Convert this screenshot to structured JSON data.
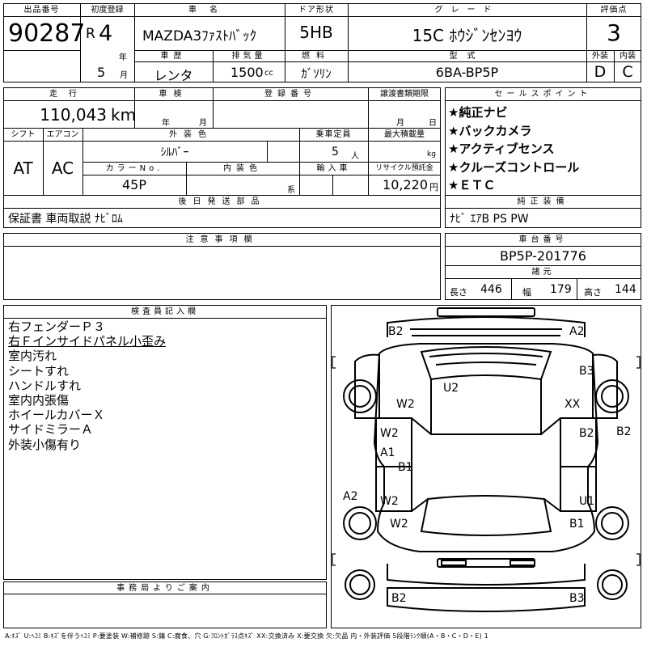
{
  "lot": {
    "header": "出品番号",
    "value": "90287"
  },
  "first_reg": {
    "header": "初度登録",
    "era": "R",
    "year": "4",
    "year_unit": "年",
    "month": "5",
    "month_unit": "月"
  },
  "car_name": {
    "header": "車名",
    "value": "MAZDA3ﾌｧｽﾄﾊﾞｯｸ"
  },
  "door": {
    "header": "ドア形状",
    "value": "5HB"
  },
  "grade": {
    "header": "グレード",
    "value": "15C ﾎｳｼﾞﾝｾﾝﾖｳ"
  },
  "score": {
    "header": "評価点",
    "value": "3"
  },
  "history": {
    "header": "車歴",
    "value": "レンタ"
  },
  "displacement": {
    "header": "排気量",
    "value": "1500",
    "unit": "cc"
  },
  "fuel": {
    "header": "燃料",
    "value": "ｶﾞｿﾘﾝ"
  },
  "model": {
    "header": "型式",
    "value": "6BA-BP5P"
  },
  "exterior_grade": {
    "header": "外装",
    "value": "D"
  },
  "interior_grade": {
    "header": "内装",
    "value": "C"
  },
  "mileage": {
    "header": "走行",
    "value": "110,043",
    "unit": "km"
  },
  "inspection": {
    "header": "車検",
    "year_unit": "年",
    "month_unit": "月"
  },
  "reg_number": {
    "header": "登録番号",
    "value": ""
  },
  "doc_deadline": {
    "header": "譲渡書類期限",
    "month_unit": "月",
    "day_unit": "日"
  },
  "shift": {
    "header": "シフト",
    "value": "AT"
  },
  "aircon": {
    "header": "エアコン",
    "value": "AC"
  },
  "ext_color": {
    "header": "外装色",
    "value": "ｼﾙﾊﾞｰ"
  },
  "capacity": {
    "header": "乗車定員",
    "value": "5",
    "unit": "人"
  },
  "max_load": {
    "header": "最大積載量",
    "value": "",
    "unit": "kg"
  },
  "color_no": {
    "header": "カラーNo.",
    "value": "45P"
  },
  "int_color": {
    "header": "内装色",
    "value": "",
    "unit": "系"
  },
  "import": {
    "header": "輸入車",
    "value": ""
  },
  "recycle": {
    "header": "リサイクル預託金",
    "value": "10,220",
    "unit": "円"
  },
  "later_parts": {
    "header": "後日発送部品",
    "value": "保証書 車両取説 ﾅﾋﾞﾛﾑ"
  },
  "sales_points": {
    "header": "セールスポイント",
    "items": [
      "★純正ナビ",
      "★バックカメラ",
      "★アクティブセンス",
      "★クルーズコントロール",
      "★ＥＴＣ"
    ]
  },
  "genuine": {
    "header": "純正装備",
    "value": "ﾅﾋﾞ ｴｱB PS PW"
  },
  "caution": {
    "header": "注意事項欄",
    "value": ""
  },
  "chassis": {
    "header": "車台番号",
    "value": "BP5P-201776"
  },
  "dims": {
    "header": "諸元",
    "length_label": "長さ",
    "length": "446",
    "width_label": "幅",
    "width": "179",
    "height_label": "高さ",
    "height": "144"
  },
  "inspector": {
    "header": "検査員記入欄",
    "lines": [
      "右フェンダーＰ３",
      "右Ｆインサイドパネル小歪み",
      "室内汚れ",
      "シートすれ",
      "ハンドルすれ",
      "室内内張傷",
      "ホイールカバーＸ",
      "サイドミラーＡ",
      "外装小傷有り"
    ]
  },
  "diagram": {
    "marks": [
      {
        "id": "front-left",
        "text": "B2"
      },
      {
        "id": "front-right",
        "text": "A2"
      },
      {
        "id": "fender-right",
        "text": "B3"
      },
      {
        "id": "roof",
        "text": "U2"
      },
      {
        "id": "hood-left",
        "text": "W2"
      },
      {
        "id": "wheel-front-right",
        "text": "XX"
      },
      {
        "id": "door-front-left",
        "text": "W2"
      },
      {
        "id": "door-front-right",
        "text": "B2"
      },
      {
        "id": "side-right",
        "text": "B2"
      },
      {
        "id": "pillar-left",
        "text": "A1"
      },
      {
        "id": "center",
        "text": "B1"
      },
      {
        "id": "side-left",
        "text": "A2"
      },
      {
        "id": "door-rear-left",
        "text": "W2"
      },
      {
        "id": "door-rear-right",
        "text": "U1"
      },
      {
        "id": "quarter-left",
        "text": "W2"
      },
      {
        "id": "quarter-right",
        "text": "B1"
      },
      {
        "id": "rear-left",
        "text": "B2"
      },
      {
        "id": "rear-right",
        "text": "B3"
      }
    ]
  },
  "office": {
    "header": "事務局よりご案内",
    "value": ""
  },
  "legend": "A:ｷｽﾞ U:ﾍｺﾐ B:ｷｽﾞを伴うﾍｺﾐ P:要塗装 W:補修跡 S:錆 C:腐食、穴 G:ﾌﾛﾝﾄｶﾞﾗｽ点ｷｽﾞ XX:交換済み X:要交換 欠:欠品 内・外装評価 5段階ﾗﾝｸ順(A・B・C・D・E) 1"
}
